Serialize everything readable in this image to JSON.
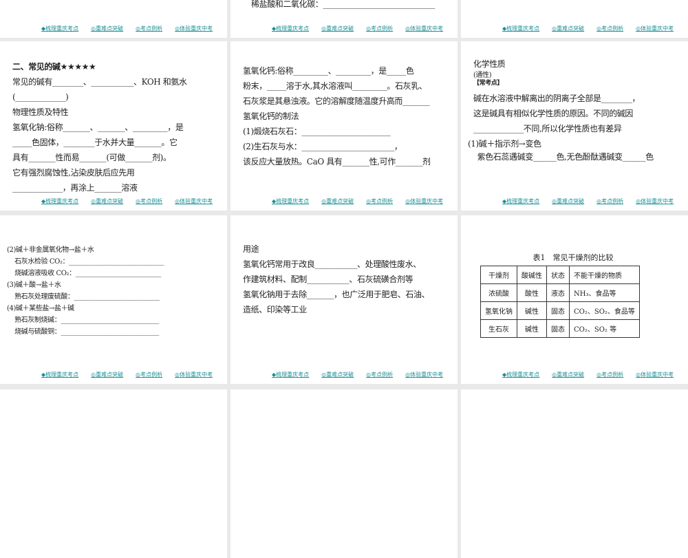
{
  "footer_links": [
    "◆梳理重庆考点",
    "◎重难点突破",
    "◎考点例析",
    "◎体验重庆中考"
  ],
  "top_partial": {
    "line": "稀盐酸和二氧化碳：_____________________________"
  },
  "slide1": {
    "title": "二、常见的碱★★★★★",
    "lines": [
      "常见的碱有________、___________、KOH 和氨水",
      "(_____________)",
      "物理性质及特性",
      "氢氧化钠:俗称_______、_______、_________，是",
      "_____色固体，________于水并大量_______。它",
      "具有_______性而易_______(可做_______剂)。",
      "它有强烈腐蚀性,沾染皮肤后应先用",
      "_____________，再涂上_______溶液"
    ]
  },
  "slide2": {
    "lines": [
      "氢氧化钙:俗称_________、_________，是_____色",
      "粉末，_____溶于水,其水溶液叫_________。石灰乳、",
      "石灰浆是其悬浊液。它的溶解度随温度升高而_______",
      "氢氧化钙的制法",
      "(1)煅烧石灰石：_______________________",
      "(2)生石灰与水：________________________，",
      "该反应大量放热。CaO 具有_______性,可作_______剂"
    ]
  },
  "slide3": {
    "title": "化学性质",
    "subtitle": "(通性)",
    "tag": "【常考点】",
    "lines": [
      "碱在水溶液中解离出的阴离子全部是________，",
      "这是碱具有相似化学性质的原因。不同的碱因",
      "_____________不同,所以化学性质也有差异",
      "(1)碱＋指示剂→变色",
      "    紫色石蕊遇碱变______色,无色酚酞遇碱变______色"
    ]
  },
  "slide4": {
    "lines": [
      "(2)碱＋非金属氧化物→盐＋水",
      "    石灰水检验 CO₂：______________________________",
      "    烧碱溶液吸收 CO₂：___________________________",
      "(3)碱＋酸→盐＋水",
      "    熟石灰处理废硫酸：___________________________",
      "(4)碱＋某些盐→盐＋碱",
      "    熟石灰制烧碱：_______________________________",
      "    烧碱与硫酸铜：_______________________________"
    ]
  },
  "slide5": {
    "lines": [
      "用途",
      "氢氧化钙常用于改良___________、处理酸性废水、",
      "作建筑材料、配制___________、石灰硫磺合剂等",
      "氢氧化钠用于去除_______，也广泛用于肥皂、石油、",
      "造纸、印染等工业"
    ]
  },
  "slide6": {
    "caption": "表1　常见干燥剂的比较",
    "headers": [
      "干燥剂",
      "酸碱性",
      "状态",
      "不能干燥的物质"
    ],
    "rows": [
      [
        "浓硫酸",
        "酸性",
        "液态",
        "NH₃、食品等"
      ],
      [
        "氢氧化钠",
        "碱性",
        "固态",
        "CO₂、SO₂、食品等"
      ],
      [
        "生石灰",
        "碱性",
        "固态",
        "CO₂、SO₂ 等"
      ]
    ]
  }
}
